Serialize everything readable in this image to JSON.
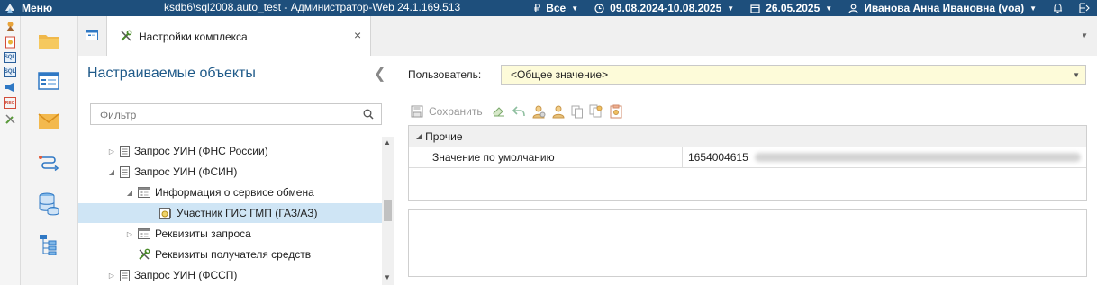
{
  "topbar": {
    "menu_label": "Меню",
    "window_title": "ksdb6\\sql2008.auto_test - Администратор-Web 24.1.169.513",
    "currency_symbol": "₽",
    "currency_value": "Все",
    "period_value": "09.08.2024-10.08.2025",
    "date_value": "26.05.2025",
    "user_value": "Иванова Анна Ивановна (voa)"
  },
  "left_strip": {
    "icons": [
      "wizard-icon",
      "document-settings-icon",
      "sql-icon",
      "sql-icon",
      "megaphone-icon",
      "report-icon",
      "tools-icon"
    ],
    "labels": [
      "SQL",
      "SQL",
      "REC"
    ]
  },
  "nav": {
    "icons": [
      "folder-icon",
      "form-icon",
      "mail-icon",
      "route-icon",
      "database-icon",
      "hierarchy-icon"
    ]
  },
  "tab": {
    "label": "Настройки комплекса",
    "close_glyph": "×"
  },
  "left_panel": {
    "title": "Настраиваемые объекты",
    "filter_placeholder": "Фильтр",
    "tree": [
      {
        "label": "Запрос УИН (ФНС России)",
        "expander": "▷",
        "icon": "document-icon"
      },
      {
        "label": "Запрос УИН (ФСИН)",
        "expander": "◢",
        "icon": "document-icon"
      },
      {
        "label": "Информация о сервисе обмена",
        "expander": "◢",
        "icon": "form-icon"
      },
      {
        "label": "Участник ГИС ГМП (ГАЗ/АЗ)",
        "expander": "",
        "icon": "settings-form-icon",
        "selected": true
      },
      {
        "label": "Реквизиты запроса",
        "expander": "▷",
        "icon": "form-icon"
      },
      {
        "label": "Реквизиты получателя средств",
        "expander": "",
        "icon": "tools-icon"
      },
      {
        "label": "Запрос УИН (ФССП)",
        "expander": "▷",
        "icon": "document-icon"
      }
    ]
  },
  "right_panel": {
    "user_label": "Пользователь:",
    "user_value": "<Общее значение>",
    "toolbar": {
      "save_label": "Сохранить",
      "icons": [
        "eraser-icon",
        "undo-icon",
        "user-settings-icon",
        "user-icon",
        "copy-icon",
        "copy-settings-icon",
        "clipboard-icon"
      ]
    },
    "grid": {
      "category": "Прочие",
      "rows": [
        {
          "key": "Значение по умолчанию",
          "value": "1654004615"
        }
      ]
    }
  },
  "colors": {
    "topbar_bg": "#1e4f7c",
    "selected_row": "#cfe5f5",
    "title_blue": "#1f5a89",
    "select_bg": "#fdfbd9"
  }
}
